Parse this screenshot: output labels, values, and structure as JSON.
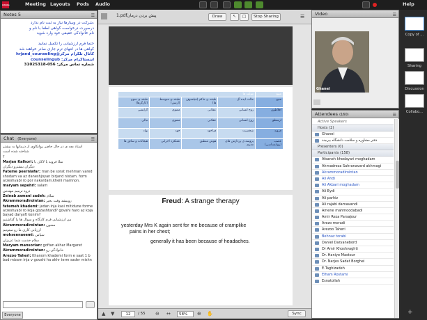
{
  "topbar": {
    "logo": "Adobe",
    "menus": [
      "Meeting",
      "Layouts",
      "Pods",
      "Audio"
    ],
    "help": "Help"
  },
  "notes": {
    "title": "Notes 5",
    "lines": [
      "،شرکت در وبینارها نیاز به ثبت نام ندارد",
      "درصورت درخواست گواهی لطفا با نام و",
      "نام خانوادگی حقیقی خود وارد شوید",
      "",
      "حتما فرم ارزشیابی را تکمیل نمایید",
      "گواهی ها در انتهای ترم جاری صادر خواهند شد",
      "کانال تلگرام مرکز@hrjand_counseling",
      "اینستاگرام مرکز: counselingub",
      "شماره تماس مرکز: 056-31025318"
    ]
  },
  "chat": {
    "title": "Chat",
    "scope": "(Everyone)",
    "messages": [
      {
        "name": "",
        "text": "استاد بچه ی در حال حاضر روانکاوی از درمانها به بیشتر"
      },
      {
        "name": "",
        "text": "شناخته شده است"
      },
      {
        "name": "",
        "text": "؟"
      },
      {
        "name": "Marjan Kalhori:",
        "text": "مثلا فروید یا لاکان یا"
      },
      {
        "name": "",
        "text": "دیگران بیشترو دیگران"
      },
      {
        "name": "Fateme peerniafar:",
        "text": "man be sorat mehman vared shodam va az  daneshjoyan birjand nistam. form arzeshyabi ro por nakardam.kheili mamnon."
      },
      {
        "name": "maryam sepehri:",
        "text": "salam"
      },
      {
        "name": "",
        "text": "درود ترمیم مهندس"
      },
      {
        "name": "Zeinab zamani zadeh:",
        "text": "سلام"
      },
      {
        "name": "Akrammoradirointan:",
        "text": "روبیشد وقت بخیر"
      },
      {
        "name": "fatemeh khademi:",
        "text": "jedan inja kasi mitidune forme arzeshyabi ro koja gozashtand? govahi haro az koja bayad daryaft konim?"
      },
      {
        "name": "",
        "text": "من ارزشیابی فرم کارگاه و سوال ها را گذاشتیم"
      },
      {
        "name": "Akrammoradirointan:",
        "text": "ممنون"
      },
      {
        "name": "",
        "text": "ارزیابی کاری ما رو میتونیم"
      },
      {
        "name": "mohsennaeemi:",
        "text": "سپاس"
      },
      {
        "name": "",
        "text": "سلام خدمت شما عزیزان"
      },
      {
        "name": "Maryam mansorian:",
        "text": "goftan akhar Margaret"
      },
      {
        "name": "Akrammoradirointan:",
        "text": "خانوادگی رو"
      },
      {
        "name": "Arezoo Taheri:",
        "text": "Khanom khademi form e saat 1 b bad mizam inja v govahi ha akhr term sader mishn"
      }
    ],
    "input_placeholder": "",
    "footer_scope": "Everyone"
  },
  "share": {
    "filename": "1.pdfپیش بردن درمان",
    "draw_label": "Draw",
    "stop_label": "Stop Sharing",
    "table_header": [
      "منبع",
      "مولفه ها"
    ],
    "table_rows": [
      [
        "منبع",
        "حالت ایده آل",
        "طبقه ی حاکم (فیلسوف ها)",
        "طبقه ی متوسط (ارتش)",
        "طبقه ی سوم (کارگرها)"
      ],
      [
        "افلاطون",
        "روح انسانی",
        "عقلانی",
        "معنوی",
        "گرایشی"
      ],
      [
        "ارسطو",
        "روح انسانی",
        "عقلانی",
        "معنوی",
        "تبالی"
      ],
      [
        "فروید",
        "شخصیت",
        "فراخود",
        "خود",
        "نهاد"
      ],
      [
        "عصب (روانشناسی)",
        "پروسه ی پردازش های مغزی",
        "هوش منطبق",
        "عملکرد اجرایی",
        "هیجانات و سائق ها"
      ]
    ],
    "slide2_title_bold": "Freud",
    "slide2_title_rest": ": A strange therapy",
    "slide2_line1": "yesterday Mrs K again sent for me because of cramplike",
    "slide2_line2": "pains in her chest;",
    "slide2_line3": "generally it has been because of headaches.",
    "page_current": "12",
    "page_total": "/ 55",
    "zoom": "58%",
    "sync_label": "Sync"
  },
  "video": {
    "title": "Video",
    "presenter_name": "Ghanei"
  },
  "attendees": {
    "title": "Attendees",
    "count": "(160)",
    "active_speakers": "Active Speakers",
    "hosts_label": "Hosts (2)",
    "hosts": [
      "Ghanei",
      "دفتر مشاوره و سلامت دانشگاه بیرجند"
    ],
    "presenters_label": "Presenters (0)",
    "participants_label": "Participants (158)",
    "participants": [
      {
        "name": "Afsaneh khodayari moghadam",
        "blue": false
      },
      {
        "name": "Ahmadreza Sahranavard akhmagi",
        "blue": false
      },
      {
        "name": "Akrammoradirointan",
        "blue": true
      },
      {
        "name": "Ali Ahdi",
        "blue": true
      },
      {
        "name": "Ali Akbari moghadam",
        "blue": true
      },
      {
        "name": "Ali Eydi",
        "blue": false
      },
      {
        "name": "Ali parhiz",
        "blue": false
      },
      {
        "name": "Ali rajabi damavandi",
        "blue": false
      },
      {
        "name": "Amene mahmoodabadi",
        "blue": false
      },
      {
        "name": "Amir Reza Parsajour",
        "blue": false
      },
      {
        "name": "Arezo moradi",
        "blue": false
      },
      {
        "name": "Arezoo Taheri",
        "blue": false
      },
      {
        "name": "Behnaz torabi",
        "blue": true
      },
      {
        "name": "Daniel Daryanebord",
        "blue": false
      },
      {
        "name": "Dr Amir Khoshvaghti",
        "blue": false
      },
      {
        "name": "Dr. Haniye Mastour",
        "blue": false
      },
      {
        "name": "Dr. Narjes Sadat Borghei",
        "blue": false
      },
      {
        "name": "E.Taghizadeh",
        "blue": false
      },
      {
        "name": "Elham Rostami",
        "blue": true
      },
      {
        "name": "Esnatollah",
        "blue": false
      }
    ]
  },
  "rail": {
    "items": [
      "Copy of ...",
      "Sharing",
      "Discussion",
      "Collabo..."
    ]
  }
}
